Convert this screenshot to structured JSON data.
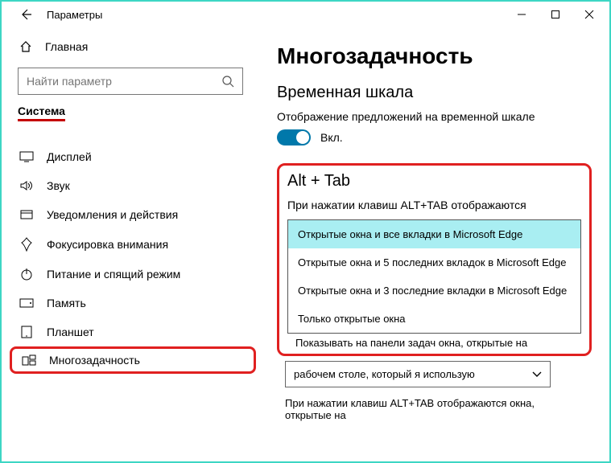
{
  "window": {
    "title": "Параметры"
  },
  "titlebar": {
    "minimize": "—",
    "maximize": "☐",
    "close": "✕"
  },
  "sidebar": {
    "home": "Главная",
    "search_placeholder": "Найти параметр",
    "section": "Система",
    "items": [
      "Дисплей",
      "Звук",
      "Уведомления и действия",
      "Фокусировка внимания",
      "Питание и спящий режим",
      "Память",
      "Планшет",
      "Многозадачность"
    ]
  },
  "main": {
    "title": "Многозадачность",
    "timeline_heading": "Временная шкала",
    "timeline_desc": "Отображение предложений на временной шкале",
    "toggle_label": "Вкл.",
    "alttab_heading": "Alt + Tab",
    "alttab_desc": "При нажатии клавиш ALT+TAB отображаются",
    "alttab_options": [
      "Открытые окна и все вкладки в Microsoft Edge",
      "Открытые окна и 5 последних вкладок в Microsoft Edge",
      "Открытые окна и 3 последние вкладки в Microsoft Edge",
      "Только открытые окна"
    ],
    "taskbar_desc": "Показывать на панели задач окна, открытые на",
    "taskbar_select": "рабочем столе, который я использую",
    "alttab_desc2": "При нажатии клавиш ALT+TAB отображаются окна, открытые на"
  }
}
